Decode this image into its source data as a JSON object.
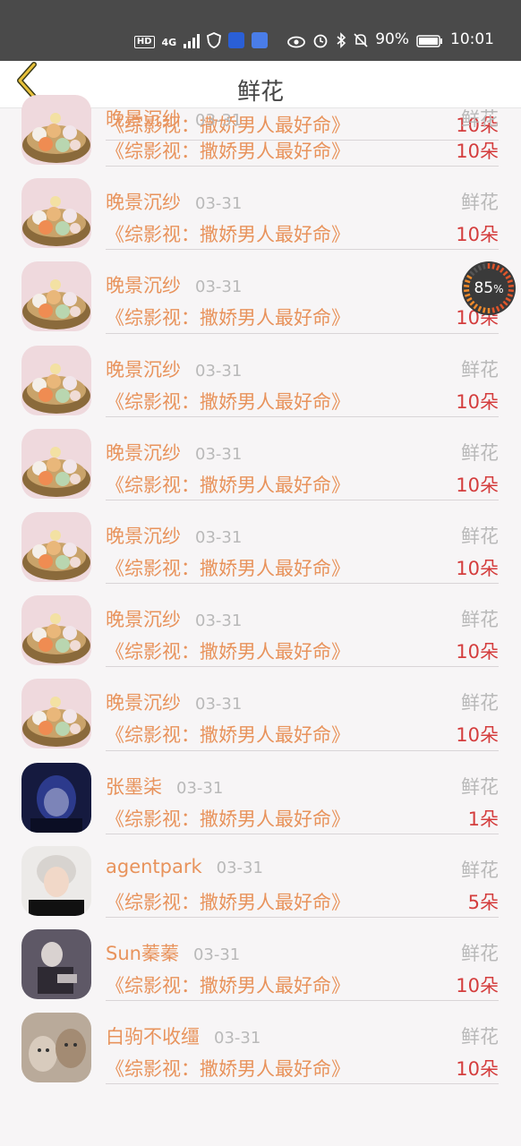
{
  "status": {
    "hd": "HD",
    "net": "4G",
    "battery": "90%",
    "time": "10:01"
  },
  "header": {
    "title": "鲜花"
  },
  "gauge": {
    "value": "85",
    "unit": "%",
    "percent": 0.85
  },
  "rows": [
    {
      "name": "晚景沉纱",
      "date": "03-31",
      "type": "鲜花",
      "book": "《综影视：撒娇男人最好命》",
      "amount": "10朵",
      "avatar": "food"
    },
    {
      "name": "晚景沉纱",
      "date": "03-31",
      "type": "鲜花",
      "book": "《综影视：撒娇男人最好命》",
      "amount": "10朵",
      "avatar": "food"
    },
    {
      "name": "晚景沉纱",
      "date": "03-31",
      "type": "鲜花",
      "book": "《综影视：撒娇男人最好命》",
      "amount": "10朵",
      "avatar": "food"
    },
    {
      "name": "晚景沉纱",
      "date": "03-31",
      "type": "鲜花",
      "book": "《综影视：撒娇男人最好命》",
      "amount": "10朵",
      "avatar": "food"
    },
    {
      "name": "晚景沉纱",
      "date": "03-31",
      "type": "鲜花",
      "book": "《综影视：撒娇男人最好命》",
      "amount": "10朵",
      "avatar": "food"
    },
    {
      "name": "晚景沉纱",
      "date": "03-31",
      "type": "鲜花",
      "book": "《综影视：撒娇男人最好命》",
      "amount": "10朵",
      "avatar": "food"
    },
    {
      "name": "晚景沉纱",
      "date": "03-31",
      "type": "鲜花",
      "book": "《综影视：撒娇男人最好命》",
      "amount": "10朵",
      "avatar": "food"
    },
    {
      "name": "晚景沉纱",
      "date": "03-31",
      "type": "鲜花",
      "book": "《综影视：撒娇男人最好命》",
      "amount": "10朵",
      "avatar": "food"
    },
    {
      "name": "张墨柒",
      "date": "03-31",
      "type": "鲜花",
      "book": "《综影视：撒娇男人最好命》",
      "amount": "1朵",
      "avatar": "dark"
    },
    {
      "name": "agentpark",
      "date": "03-31",
      "type": "鲜花",
      "book": "《综影视：撒娇男人最好命》",
      "amount": "5朵",
      "avatar": "person"
    },
    {
      "name": "Sun蓁蓁",
      "date": "03-31",
      "type": "鲜花",
      "book": "《综影视：撒娇男人最好命》",
      "amount": "10朵",
      "avatar": "gray"
    },
    {
      "name": "白驹不收缰",
      "date": "03-31",
      "type": "鲜花",
      "book": "《综影视：撒娇男人最好命》",
      "amount": "10朵",
      "avatar": "cats"
    }
  ],
  "partial_row": {
    "book": "《综影视：撒娇男人最好命》",
    "amount": "10朵"
  }
}
